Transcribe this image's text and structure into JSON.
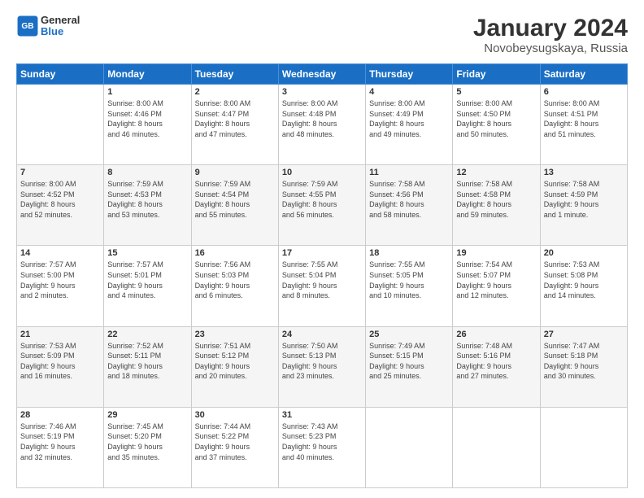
{
  "logo": {
    "text_general": "General",
    "text_blue": "Blue"
  },
  "title": "January 2024",
  "subtitle": "Novobeysugskaya, Russia",
  "header_days": [
    "Sunday",
    "Monday",
    "Tuesday",
    "Wednesday",
    "Thursday",
    "Friday",
    "Saturday"
  ],
  "weeks": [
    [
      {
        "day": "",
        "info": ""
      },
      {
        "day": "1",
        "info": "Sunrise: 8:00 AM\nSunset: 4:46 PM\nDaylight: 8 hours\nand 46 minutes."
      },
      {
        "day": "2",
        "info": "Sunrise: 8:00 AM\nSunset: 4:47 PM\nDaylight: 8 hours\nand 47 minutes."
      },
      {
        "day": "3",
        "info": "Sunrise: 8:00 AM\nSunset: 4:48 PM\nDaylight: 8 hours\nand 48 minutes."
      },
      {
        "day": "4",
        "info": "Sunrise: 8:00 AM\nSunset: 4:49 PM\nDaylight: 8 hours\nand 49 minutes."
      },
      {
        "day": "5",
        "info": "Sunrise: 8:00 AM\nSunset: 4:50 PM\nDaylight: 8 hours\nand 50 minutes."
      },
      {
        "day": "6",
        "info": "Sunrise: 8:00 AM\nSunset: 4:51 PM\nDaylight: 8 hours\nand 51 minutes."
      }
    ],
    [
      {
        "day": "7",
        "info": "Sunrise: 8:00 AM\nSunset: 4:52 PM\nDaylight: 8 hours\nand 52 minutes."
      },
      {
        "day": "8",
        "info": "Sunrise: 7:59 AM\nSunset: 4:53 PM\nDaylight: 8 hours\nand 53 minutes."
      },
      {
        "day": "9",
        "info": "Sunrise: 7:59 AM\nSunset: 4:54 PM\nDaylight: 8 hours\nand 55 minutes."
      },
      {
        "day": "10",
        "info": "Sunrise: 7:59 AM\nSunset: 4:55 PM\nDaylight: 8 hours\nand 56 minutes."
      },
      {
        "day": "11",
        "info": "Sunrise: 7:58 AM\nSunset: 4:56 PM\nDaylight: 8 hours\nand 58 minutes."
      },
      {
        "day": "12",
        "info": "Sunrise: 7:58 AM\nSunset: 4:58 PM\nDaylight: 8 hours\nand 59 minutes."
      },
      {
        "day": "13",
        "info": "Sunrise: 7:58 AM\nSunset: 4:59 PM\nDaylight: 9 hours\nand 1 minute."
      }
    ],
    [
      {
        "day": "14",
        "info": "Sunrise: 7:57 AM\nSunset: 5:00 PM\nDaylight: 9 hours\nand 2 minutes."
      },
      {
        "day": "15",
        "info": "Sunrise: 7:57 AM\nSunset: 5:01 PM\nDaylight: 9 hours\nand 4 minutes."
      },
      {
        "day": "16",
        "info": "Sunrise: 7:56 AM\nSunset: 5:03 PM\nDaylight: 9 hours\nand 6 minutes."
      },
      {
        "day": "17",
        "info": "Sunrise: 7:55 AM\nSunset: 5:04 PM\nDaylight: 9 hours\nand 8 minutes."
      },
      {
        "day": "18",
        "info": "Sunrise: 7:55 AM\nSunset: 5:05 PM\nDaylight: 9 hours\nand 10 minutes."
      },
      {
        "day": "19",
        "info": "Sunrise: 7:54 AM\nSunset: 5:07 PM\nDaylight: 9 hours\nand 12 minutes."
      },
      {
        "day": "20",
        "info": "Sunrise: 7:53 AM\nSunset: 5:08 PM\nDaylight: 9 hours\nand 14 minutes."
      }
    ],
    [
      {
        "day": "21",
        "info": "Sunrise: 7:53 AM\nSunset: 5:09 PM\nDaylight: 9 hours\nand 16 minutes."
      },
      {
        "day": "22",
        "info": "Sunrise: 7:52 AM\nSunset: 5:11 PM\nDaylight: 9 hours\nand 18 minutes."
      },
      {
        "day": "23",
        "info": "Sunrise: 7:51 AM\nSunset: 5:12 PM\nDaylight: 9 hours\nand 20 minutes."
      },
      {
        "day": "24",
        "info": "Sunrise: 7:50 AM\nSunset: 5:13 PM\nDaylight: 9 hours\nand 23 minutes."
      },
      {
        "day": "25",
        "info": "Sunrise: 7:49 AM\nSunset: 5:15 PM\nDaylight: 9 hours\nand 25 minutes."
      },
      {
        "day": "26",
        "info": "Sunrise: 7:48 AM\nSunset: 5:16 PM\nDaylight: 9 hours\nand 27 minutes."
      },
      {
        "day": "27",
        "info": "Sunrise: 7:47 AM\nSunset: 5:18 PM\nDaylight: 9 hours\nand 30 minutes."
      }
    ],
    [
      {
        "day": "28",
        "info": "Sunrise: 7:46 AM\nSunset: 5:19 PM\nDaylight: 9 hours\nand 32 minutes."
      },
      {
        "day": "29",
        "info": "Sunrise: 7:45 AM\nSunset: 5:20 PM\nDaylight: 9 hours\nand 35 minutes."
      },
      {
        "day": "30",
        "info": "Sunrise: 7:44 AM\nSunset: 5:22 PM\nDaylight: 9 hours\nand 37 minutes."
      },
      {
        "day": "31",
        "info": "Sunrise: 7:43 AM\nSunset: 5:23 PM\nDaylight: 9 hours\nand 40 minutes."
      },
      {
        "day": "",
        "info": ""
      },
      {
        "day": "",
        "info": ""
      },
      {
        "day": "",
        "info": ""
      }
    ]
  ]
}
